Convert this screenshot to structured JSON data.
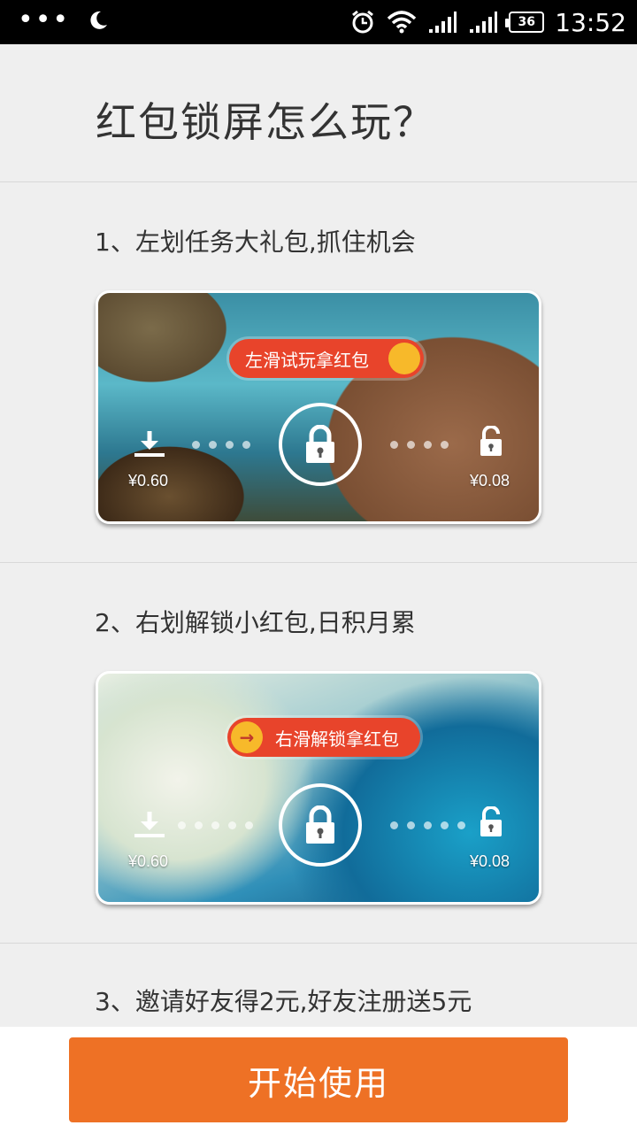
{
  "status_bar": {
    "time": "13:52",
    "battery": "36",
    "left_icons": [
      "more-dots-icon",
      "moon-icon"
    ],
    "right_icons": [
      "alarm-icon",
      "wifi-icon",
      "signal-icon",
      "signal-icon",
      "battery-icon"
    ]
  },
  "header": {
    "title": "红包锁屏怎么玩？"
  },
  "steps": [
    {
      "label": "1、左划任务大礼包,抓住机会",
      "card": {
        "pill_text": "左滑试玩拿红包",
        "left_value": "¥0.60",
        "right_value": "¥0.08"
      }
    },
    {
      "label": "2、右划解锁小红包,日积月累",
      "card": {
        "pill_text": "右滑解锁拿红包",
        "left_value": "¥0.60",
        "right_value": "¥0.08"
      }
    },
    {
      "label": "3、邀请好友得2元,好友注册送5元"
    }
  ],
  "bottom": {
    "start_button": "开始使用"
  },
  "colors": {
    "accent": "#ee7125",
    "pill": "#e8442b",
    "knob": "#f7b92a"
  }
}
